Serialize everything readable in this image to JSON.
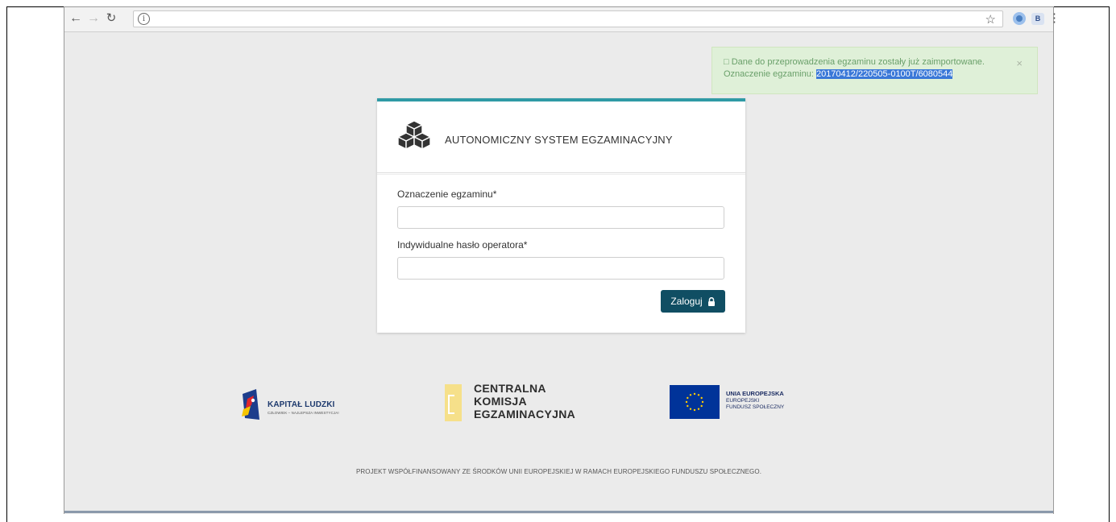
{
  "browser": {
    "back_icon": "arrow-left-icon",
    "forward_icon": "arrow-right-icon",
    "reload_icon": "reload-icon",
    "info_icon": "info-icon",
    "bookmark_icon": "star-icon",
    "extension_b_label": "B",
    "menu_icon": "vertical-dots-icon"
  },
  "alert": {
    "line1": "□ Dane do przeprowadzenia egzaminu zostały już zaimportowane.",
    "line2_prefix": "Oznaczenie egzaminu: ",
    "exam_code": "20170412/220505-0100T/6080544",
    "close_label": "×"
  },
  "login_card": {
    "title": "AUTONOMICZNY SYSTEM EGZAMINACYJNY",
    "exam_label": "Oznaczenie egzaminu*",
    "exam_value": "",
    "password_label": "Indywidualne hasło operatora*",
    "password_value": "",
    "submit_label": "Zaloguj"
  },
  "partners": {
    "kapital_ludzki": {
      "name": "KAPITAŁ LUDZKI",
      "tagline": "CZŁOWIEK – NAJLEPSZA INWESTYCJA!"
    },
    "cke": {
      "line1": "CENTRALNA",
      "line2": "KOMISJA",
      "line3": "EGZAMINACYJNA"
    },
    "ue": {
      "line1": "UNIA EUROPEJSKA",
      "line2": "EUROPEJSKI",
      "line3": "FUNDUSZ SPOŁECZNY"
    }
  },
  "footer": {
    "text": "PROJEKT WSPÓŁFINANSOWANY ZE ŚRODKÓW UNII EUROPEJSKIEJ W RAMACH EUROPEJSKIEGO FUNDUSZU SPOŁECZNEGO."
  },
  "colors": {
    "accent_teal": "#2f9aa5",
    "button_dark_teal": "#104e63",
    "alert_bg": "#dff0d8",
    "alert_text": "#6aa06a",
    "highlight_blue": "#3a78d8",
    "cke_yellow": "#f6e08a",
    "eu_blue": "#003399",
    "eu_star": "#ffcc00"
  }
}
